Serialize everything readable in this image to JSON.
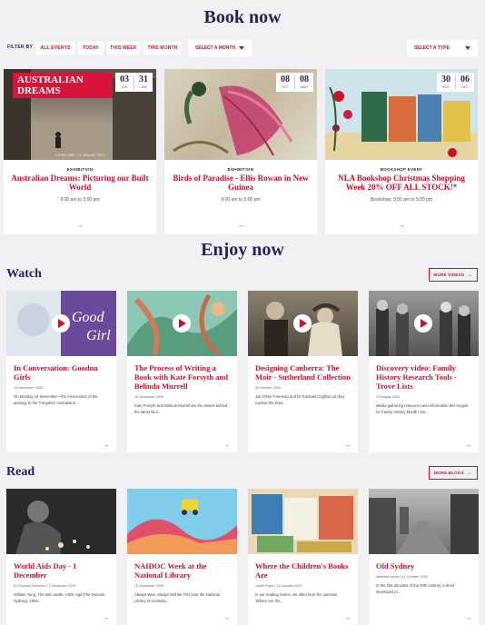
{
  "book": {
    "heading": "Book now",
    "filter_label": "FILTER BY",
    "filters": [
      "ALL EVENTS",
      "TODAY",
      "THIS WEEK",
      "THIS MONTH"
    ],
    "select_month": "SELECT A MONTH",
    "select_type": "SELECT A TYPE",
    "events": [
      {
        "category": "EXHIBITION",
        "title": "Australian Dreams: Picturing our Built World",
        "time": "9:00 am to 5:00 pm",
        "date1": "03",
        "mon1": "JUN",
        "date2": "31",
        "mon2": "JAN",
        "banner": "AUSTRALIAN DREAMS",
        "banner_sub": "3 JUNE 2020 – 31 JANUARY 2021"
      },
      {
        "category": "EXHIBITION",
        "title": "Birds of Paradise - Ellis Rowan in New Guinea",
        "time": "9:00 am to 5:00 pm",
        "date1": "08",
        "mon1": "OCT",
        "date2": "08",
        "mon2": "MAR"
      },
      {
        "category": "BOOKSHOP EVENT",
        "title": "NLA Bookshop Christmas Shopping Week 20% OFF ALL STOCK!*",
        "time": "Bookshop, 9:00 am to 5:00 pm",
        "date1": "30",
        "mon1": "NOV",
        "date2": "06",
        "mon2": "DEC"
      }
    ],
    "arrow": "→"
  },
  "enjoy": {
    "heading": "Enjoy now",
    "watch": {
      "title": "Watch",
      "more": "MORE VIDEOS",
      "cards": [
        {
          "title": "In Conversation: Goodna Girls",
          "date": "10 November 2020",
          "text": "On Monday 16 November—the Anniversary of the apology to the 'Forgotten Australians'..."
        },
        {
          "title": "The Process of Writing a Book with Kate Forsyth and Belinda Murrell",
          "date": "10 November 2020",
          "text": "Kate Forsyth and Belinda Murrell are the sisters behind the latest NLA..."
        },
        {
          "title": "Designing Canberra: The Moir - Sutherland Collection",
          "date": "06 October 2020",
          "text": "Join Peter Freeman and Dr Rachael Coghlan as they explore the lives..."
        },
        {
          "title": "Discovery video: Family History Research Tools - Trove Lists",
          "date": "21 August 2020",
          "text": "Media gathering resources and information this August for Family History Month? Do..."
        }
      ]
    },
    "read": {
      "title": "Read",
      "more": "MORE BLOGS",
      "cards": [
        {
          "title": "World Aids Day - 1 December",
          "date": "Dr Sheena Robinson | 1 December 2020",
          "text": "William Yang, The last candle, AIDS vigil [The Domain, Sydney], 1994..."
        },
        {
          "title": "NAIDOC Week at the National Library",
          "date": "| 6 November 2020",
          "text": "Always Was, Always Will Be This year the National Library of Australia..."
        },
        {
          "title": "Where the Children's Books Are",
          "date": "Judith Rope | 14 October 2020",
          "text": "In our reading rooms, we often hear the question, 'Where are the..."
        },
        {
          "title": "Old Sydney",
          "date": "Matthew Jones | 12 October 2020",
          "text": "In the first decades of the 20th century, a trend developed in..."
        }
      ]
    },
    "arrow": "→"
  },
  "colors": {
    "navy": "#2a1f5c",
    "red": "#c8102e",
    "bg": "#f1f1f3"
  },
  "icons": [
    "play-icon",
    "arrow-right-icon",
    "chevron-down-icon"
  ]
}
